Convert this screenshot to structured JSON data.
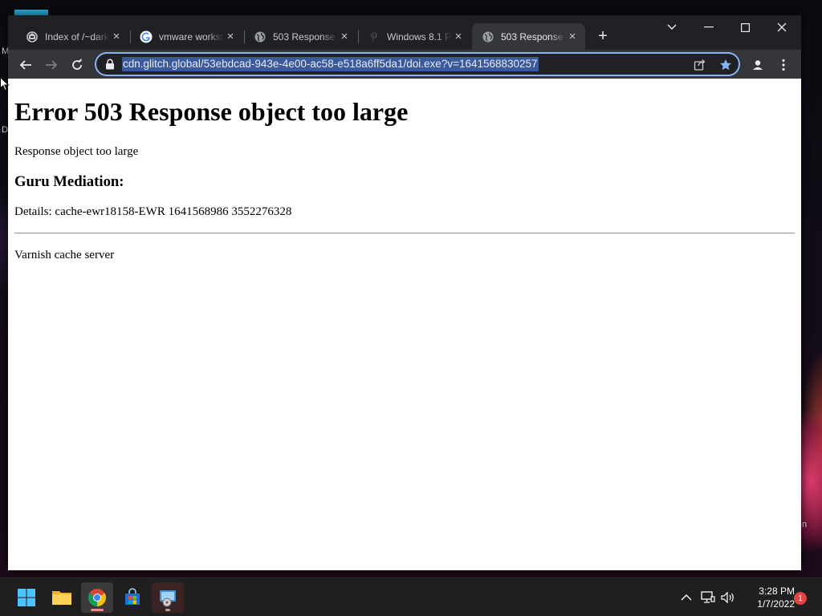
{
  "desktop": {
    "edge_labels": [
      "M",
      "D",
      "n"
    ]
  },
  "browser": {
    "tabs": [
      {
        "title": "Index of /~darkne",
        "favicon": "archive-icon",
        "active": false
      },
      {
        "title": "vmware workstation",
        "favicon": "google-icon",
        "active": false
      },
      {
        "title": "503 Response object",
        "favicon": "globe-icon",
        "active": false
      },
      {
        "title": "Windows 8.1 Pro",
        "favicon": "pinterest-icon",
        "active": false
      },
      {
        "title": "503 Response object",
        "favicon": "globe-icon",
        "active": true
      }
    ],
    "new_tab_label": "+",
    "address_bar": {
      "url": "cdn.glitch.global/53ebdcad-943e-4e00-ac58-e518a6ff5da1/doi.exe?v=1641568830257",
      "secure_icon": "lock-icon",
      "bookmarked": true
    },
    "colors": {
      "tabbar_bg": "#202124",
      "toolbar_bg": "#35363a",
      "focus_ring": "#8ab4f8",
      "bookmark_star": "#8ab4f8"
    }
  },
  "page": {
    "heading": "Error 503 Response object too large",
    "message": "Response object too large",
    "subheading": "Guru Mediation:",
    "details": "Details: cache-ewr18158-EWR 1641568986 3552276328",
    "footer": "Varnish cache server"
  },
  "taskbar": {
    "apps": [
      {
        "name": "start",
        "icon": "windows-icon"
      },
      {
        "name": "file-explorer",
        "icon": "folder-icon"
      },
      {
        "name": "chrome",
        "icon": "chrome-icon",
        "running": true
      },
      {
        "name": "microsoft-store",
        "icon": "store-icon"
      },
      {
        "name": "installer",
        "icon": "setup-icon",
        "running": true
      }
    ],
    "clock": {
      "time": "3:28 PM",
      "date": "1/7/2022"
    },
    "notification_count": "1"
  }
}
